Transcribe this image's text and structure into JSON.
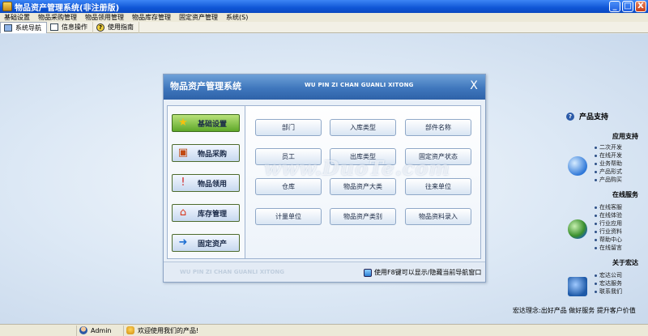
{
  "window": {
    "title": "物品资产管理系统(非注册版)",
    "controls": [
      "_",
      "□",
      "X"
    ]
  },
  "menu": [
    "基础设置",
    "物品采购管理",
    "物品领用管理",
    "物品库存管理",
    "固定资产管理",
    "系统(S)"
  ],
  "tabs": [
    {
      "label": "系统导航",
      "icon": "monitor-icon",
      "active": true
    },
    {
      "label": "信息操作",
      "icon": "document-icon",
      "active": false
    },
    {
      "label": "使用指南",
      "icon": "help-icon",
      "active": false
    }
  ],
  "nav": {
    "title": "物品资产管理系统",
    "pinyin": "WU PIN ZI CHAN GUANLI XITONG",
    "close": "X",
    "left_buttons": [
      {
        "label": "基础设置",
        "icon": "star-icon",
        "glyph": "★",
        "color": "#f5c10e"
      },
      {
        "label": "物品采购",
        "icon": "computer-icon",
        "glyph": "▣",
        "color": "#c24a12"
      },
      {
        "label": "物品领用",
        "icon": "alert-icon",
        "glyph": "!",
        "color": "#d01f1f"
      },
      {
        "label": "库存管理",
        "icon": "house-icon",
        "glyph": "⌂",
        "color": "#d8351b"
      },
      {
        "label": "固定资产",
        "icon": "arrow-icon",
        "glyph": "➜",
        "color": "#1f6fd2"
      }
    ],
    "grid": [
      "部门",
      "入库类型",
      "部件名称",
      "员工",
      "出库类型",
      "固定资产状态",
      "仓库",
      "物品资产大类",
      "往来单位",
      "计量单位",
      "物品资产类别",
      "物品资料录入"
    ],
    "footer_pinyin": "WU PIN ZI CHAN GUANLI XITONG",
    "footer_hint": "使用F8键可以显示/隐藏当前导航窗口"
  },
  "watermark": "www.DuoTe.com",
  "support": {
    "title": "产品支持",
    "sections": [
      {
        "head": "应用支持",
        "links": [
          "二次开发",
          "在线开发",
          "业务帮助",
          "产品形式",
          "产品购买"
        ]
      },
      {
        "head": "在线服务",
        "links": [
          "在线客服",
          "在线体验",
          "行业应用",
          "行业资料",
          "帮助中心",
          "在线留言"
        ]
      },
      {
        "head": "关于宏达",
        "links": [
          "宏达公司",
          "宏达服务",
          "联系我们"
        ]
      }
    ]
  },
  "motto": "宏达理念:出好产品 做好服务 提升客户价值",
  "status": {
    "user": "Admin",
    "welcome": "欢迎使用我们的产品!"
  },
  "colors": {
    "header_blue": "#3f77bd",
    "first_button_green": "#5fa82a"
  }
}
